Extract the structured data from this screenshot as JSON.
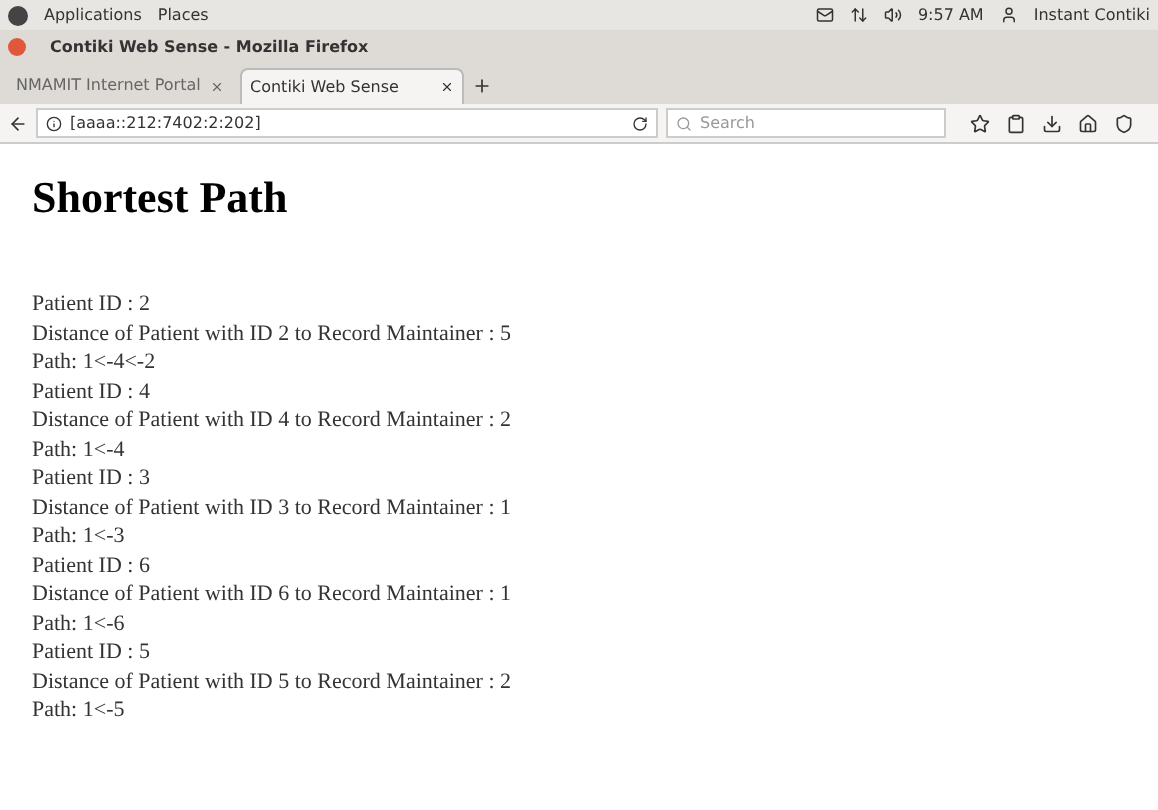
{
  "top_panel": {
    "menus": [
      "Applications",
      "Places"
    ],
    "time": "9:57 AM",
    "user": "Instant Contiki"
  },
  "window": {
    "title": "Contiki Web Sense - Mozilla Firefox"
  },
  "tabs": [
    {
      "label": "NMAMIT Internet Portal",
      "selected": false
    },
    {
      "label": "Contiki Web Sense",
      "selected": true
    }
  ],
  "address_bar": {
    "value": "[aaaa::212:7402:2:202]"
  },
  "search": {
    "placeholder": "Search"
  },
  "page": {
    "heading": "Shortest Path",
    "lines": [
      "Patient ID : 2",
      "Distance of Patient with ID 2 to Record Maintainer : 5",
      "Path: 1<-4<-2",
      "Patient ID : 4",
      "Distance of Patient with ID 4 to Record Maintainer : 2",
      "Path: 1<-4",
      "Patient ID : 3",
      "Distance of Patient with ID 3 to Record Maintainer : 1",
      "Path: 1<-3",
      "Patient ID : 6",
      "Distance of Patient with ID 6 to Record Maintainer : 1",
      "Path: 1<-6",
      "Patient ID : 5",
      "Distance of Patient with ID 5 to Record Maintainer : 2",
      "Path: 1<-5"
    ]
  }
}
